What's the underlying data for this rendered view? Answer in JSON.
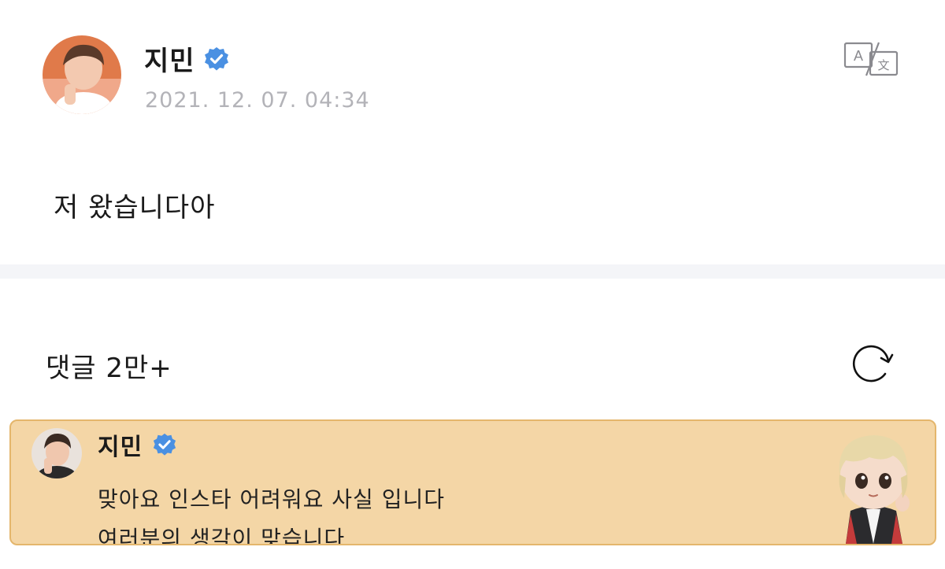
{
  "post": {
    "author": "지민",
    "timestamp": "2021. 12. 07. 04:34",
    "body": "저 왔습니다아"
  },
  "icons": {
    "verified": "verified-badge-icon",
    "translate": "translate-icon",
    "refresh": "refresh-icon"
  },
  "comments": {
    "title": "댓글 2만+"
  },
  "highlighted_comment": {
    "author": "지민",
    "lines": [
      "맞아요 인스타 어려워요 사실 입니다",
      "여러분의 생각이 맞습니다"
    ]
  },
  "colors": {
    "verified_blue": "#4a90e2",
    "timestamp_gray": "#b3b3b8",
    "comment_bg": "#f4d6a6",
    "comment_border": "#e4b66c",
    "divider": "#f4f5f8"
  }
}
